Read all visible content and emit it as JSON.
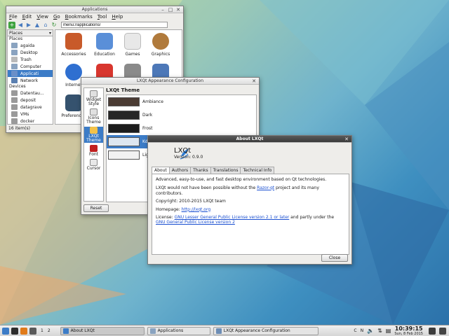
{
  "file_manager": {
    "title": "Applications",
    "menu": [
      "File",
      "Edit",
      "View",
      "Go",
      "Bookmarks",
      "Tool",
      "Help"
    ],
    "path": "menu://applications/",
    "places_header": "Places",
    "places_group": "Places",
    "places": [
      {
        "label": "agaida",
        "icon": "home-icon"
      },
      {
        "label": "Desktop",
        "icon": "desktop-icon"
      },
      {
        "label": "Trash",
        "icon": "trash-icon"
      },
      {
        "label": "Computer",
        "icon": "computer-icon"
      },
      {
        "label": "Applicati",
        "icon": "applications-icon"
      },
      {
        "label": "Network",
        "icon": "network-icon"
      }
    ],
    "devices_group": "Devices",
    "devices": [
      {
        "label": "Datentau..."
      },
      {
        "label": "deposit"
      },
      {
        "label": "datagrave"
      },
      {
        "label": "VMs"
      },
      {
        "label": "docker"
      }
    ],
    "files": [
      {
        "label": "Accessories",
        "icon": "accessories-icon",
        "color": "#c85a2a"
      },
      {
        "label": "Education",
        "icon": "education-icon",
        "color": "#5a8fd8"
      },
      {
        "label": "Games",
        "icon": "games-icon",
        "color": "#e8e8e8"
      },
      {
        "label": "Graphics",
        "icon": "graphics-icon",
        "color": "#b07a3c"
      },
      {
        "label": "Internet",
        "icon": "internet-icon",
        "color": "#2f6fd0"
      },
      {
        "label": "",
        "icon": "power-icon",
        "color": "#d8362e"
      },
      {
        "label": "",
        "icon": "typewriter-icon",
        "color": "#8a8a8a"
      },
      {
        "label": "",
        "icon": "system-tools-icon",
        "color": "#4d78b8"
      },
      {
        "label": "Preferences",
        "icon": "preferences-icon",
        "color": "#35526e"
      }
    ],
    "status": "16 item(s)"
  },
  "appearance": {
    "title": "LXQt Appearance Configuration",
    "categories": [
      {
        "label": "Widget Style"
      },
      {
        "label": "Icons Theme"
      },
      {
        "label": "LXQt Theme"
      },
      {
        "label": "Font"
      },
      {
        "label": "Cursor"
      }
    ],
    "heading": "LXQt Theme",
    "themes": [
      {
        "label": "Ambiance",
        "preview": "#4a3b33"
      },
      {
        "label": "Dark",
        "preview": "#262626"
      },
      {
        "label": "Frost",
        "preview": "#1c1c1c"
      },
      {
        "label": "Kde",
        "preview": "#dde6f0"
      },
      {
        "label": "Ligh",
        "preview": "#f2f2f2"
      }
    ],
    "reset": "Reset"
  },
  "about": {
    "title": "About LXQt",
    "name": "LXQt",
    "version": "Version: 0.9.0",
    "tabs": [
      "About",
      "Authors",
      "Thanks",
      "Translations",
      "Technical Info"
    ],
    "line1": "Advanced, easy-to-use, and fast desktop environment based on Qt technologies.",
    "line2_pre": "LXQt would not have been possible without the ",
    "line2_link": "Razor-qt",
    "line2_post": " project and its many contributors.",
    "copyright": "Copyright: 2010-2015 LXQt team",
    "homepage_label": "Homepage: ",
    "homepage_link": "http://lxqt.org",
    "license_label": "License: ",
    "license_link1": "GNU Lesser General Public License version 2.1 or later",
    "license_mid": " and partly under the",
    "license_link2": "GNU General Public License version 2",
    "close": "Close"
  },
  "panel": {
    "desktops": [
      "1",
      "2"
    ],
    "tasks": [
      {
        "label": "About LXQt"
      },
      {
        "label": "Applications"
      },
      {
        "label": "LXQt Appearance Configuration"
      }
    ],
    "tray": [
      "C",
      "N"
    ],
    "time": "10:39:15",
    "date": "Sun, 8 Feb 2015"
  }
}
